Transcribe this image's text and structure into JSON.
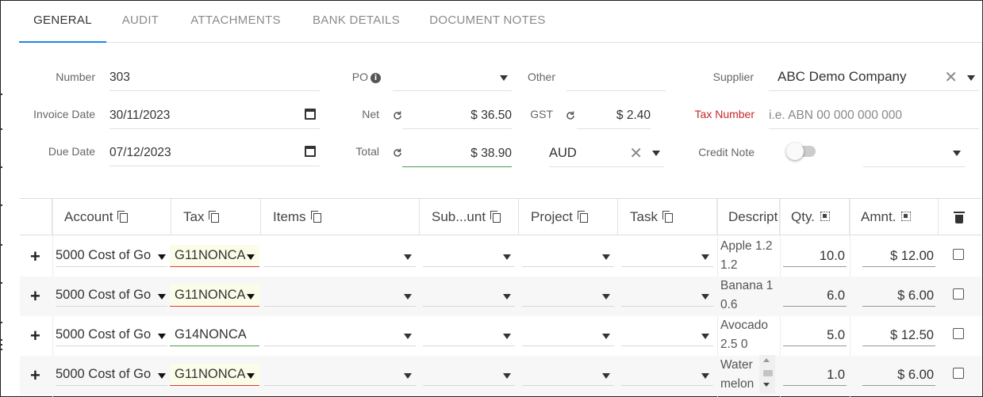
{
  "tabs": [
    "GENERAL",
    "AUDIT",
    "ATTACHMENTS",
    "BANK DETAILS",
    "DOCUMENT NOTES"
  ],
  "active_tab": "GENERAL",
  "form": {
    "number_label": "Number",
    "number_value": "303",
    "po_label": "PO",
    "po_value": "",
    "other_label": "Other",
    "other_value": "",
    "supplier_label": "Supplier",
    "supplier_value": "ABC Demo Company",
    "invoice_date_label": "Invoice Date",
    "invoice_date_value": "30/11/2023",
    "net_label": "Net",
    "net_value": "$ 36.50",
    "gst_label": "GST",
    "gst_value": "$ 2.40",
    "tax_number_label": "Tax Number",
    "tax_number_placeholder": "i.e. ABN 00 000 000 000",
    "due_date_label": "Due Date",
    "due_date_value": "07/12/2023",
    "total_label": "Total",
    "total_value": "$ 38.90",
    "currency_value": "AUD",
    "credit_note_label": "Credit Note",
    "credit_note_on": false
  },
  "grid": {
    "columns": [
      "Account",
      "Tax",
      "Items",
      "Sub...unt",
      "Project",
      "Task",
      "Descript",
      "Qty.",
      "Amnt."
    ],
    "rows": [
      {
        "account": "5000 Cost of Go",
        "tax": "G11NONCA",
        "tax_status": "invalid",
        "desc1": "Apple 1.2",
        "desc2": "1.2",
        "qty": "10.0",
        "amount": "$ 12.00"
      },
      {
        "account": "5000 Cost of Go",
        "tax": "G11NONCA",
        "tax_status": "invalid",
        "desc1": "Banana 1",
        "desc2": "0.6",
        "qty": "6.0",
        "amount": "$ 6.00"
      },
      {
        "account": "5000 Cost of Go",
        "tax": "G14NONCA",
        "tax_status": "valid",
        "desc1": "Avocado",
        "desc2": "2.5 0",
        "qty": "5.0",
        "amount": "$ 12.50"
      },
      {
        "account": "5000 Cost of Go",
        "tax": "G11NONCA",
        "tax_status": "invalid",
        "desc1": "Water",
        "desc2": "melon",
        "qty": "1.0",
        "amount": "$ 6.00"
      }
    ]
  },
  "colors": {
    "accent": "#1e88e5",
    "error": "#e53935",
    "valid": "#43a047",
    "tax_label": "#c62828"
  },
  "icons": [
    "info-icon",
    "calendar-icon",
    "refresh-icon",
    "clear-icon",
    "dropdown-icon",
    "copy-icon",
    "select-all-icon",
    "trash-icon",
    "add-icon"
  ]
}
